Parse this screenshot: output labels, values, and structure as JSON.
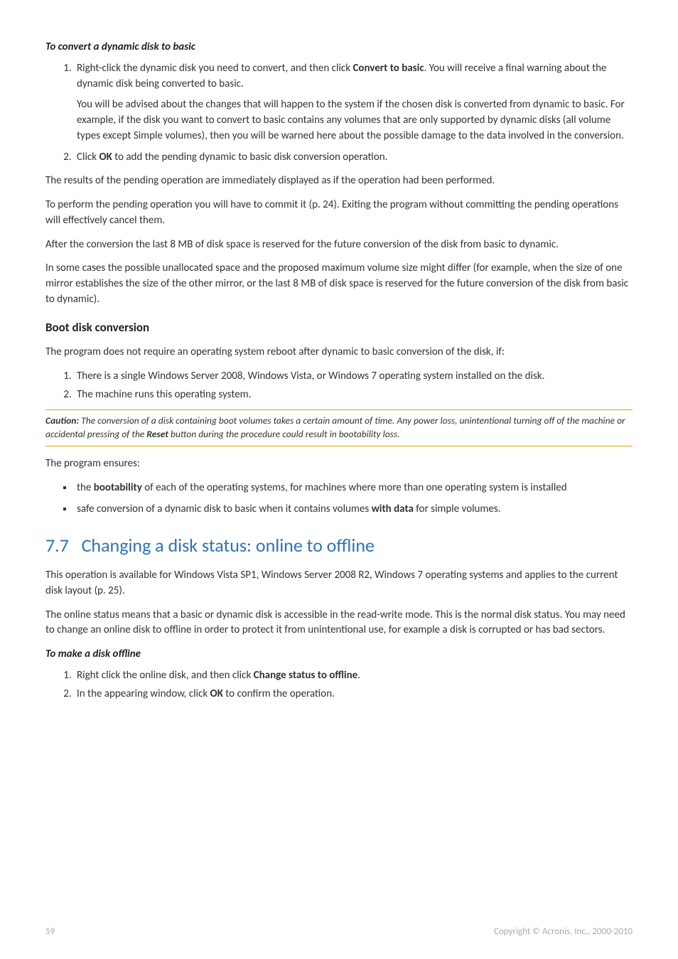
{
  "section1": {
    "title": "To convert a dynamic disk to basic",
    "step1_p1_a": "Right-click the dynamic disk you need to convert, and then click ",
    "step1_p1_b": "Convert to basic",
    "step1_p1_c": ". You will receive a final warning about the dynamic disk being converted to basic.",
    "step1_p2": "You will be advised about the changes that will happen to the system if the chosen disk is converted from dynamic to basic. For example, if the disk you want to convert to basic contains any volumes that are only supported by dynamic disks (all volume types except Simple volumes), then you will be warned here about the possible damage to the data involved in the conversion.",
    "step2_a": "Click ",
    "step2_b": "OK",
    "step2_c": " to add the pending dynamic to basic disk conversion operation.",
    "para1": "The results of the pending operation are immediately displayed as if the operation had been performed.",
    "para2": "To perform the pending operation you will have to commit it (p. 24). Exiting the program without committing the pending operations will effectively cancel them.",
    "para3": "After the conversion the last 8 MB of disk space is reserved for the future conversion of the disk from basic to dynamic.",
    "para4": "In some cases the possible unallocated space and the proposed maximum volume size might differ (for example, when the size of one mirror establishes the size of the other mirror, or the last 8 MB of disk space is reserved for the future conversion of the disk from basic to dynamic)."
  },
  "section2": {
    "title": "Boot disk conversion",
    "para1": "The program does not require an operating system reboot after dynamic to basic conversion of the disk, if:",
    "step1": "There is a single Windows Server 2008, Windows Vista, or Windows 7 operating system installed on the disk.",
    "step2": "The machine runs this operating system.",
    "caution_label": "Caution:",
    "caution_a": " The conversion of a disk containing boot volumes takes a certain amount of time. Any power loss, unintentional turning off of the machine or accidental pressing of the ",
    "caution_b": "Reset",
    "caution_c": " button during the procedure could result in bootability loss.",
    "para2": "The program ensures:",
    "bullet1_a": "the ",
    "bullet1_b": "bootability",
    "bullet1_c": " of each of the operating systems, for machines where more than one operating system is installed",
    "bullet2_a": "safe conversion of a dynamic disk to basic when it contains volumes ",
    "bullet2_b": "with data",
    "bullet2_c": " for simple volumes."
  },
  "section3": {
    "number": "7.7",
    "title": "Changing a disk status: online to offline",
    "para1": "This operation is available for Windows Vista SP1, Windows Server 2008 R2, Windows 7 operating systems and applies to the current disk layout (p. 25).",
    "para2": "The online status means that a basic or dynamic disk is accessible in the read-write mode. This is the normal disk status. You may need to change an online disk to offline in order to protect it from unintentional use, for example a disk is corrupted or has bad sectors.",
    "subtitle": "To make a disk offline",
    "step1_a": "Right click the online disk, and then click ",
    "step1_b": "Change status to offline",
    "step1_c": ".",
    "step2_a": "In the appearing window, click ",
    "step2_b": "OK",
    "step2_c": " to confirm the operation."
  },
  "footer": {
    "page": "59",
    "copyright": "Copyright © Acronis, Inc., 2000-2010"
  }
}
